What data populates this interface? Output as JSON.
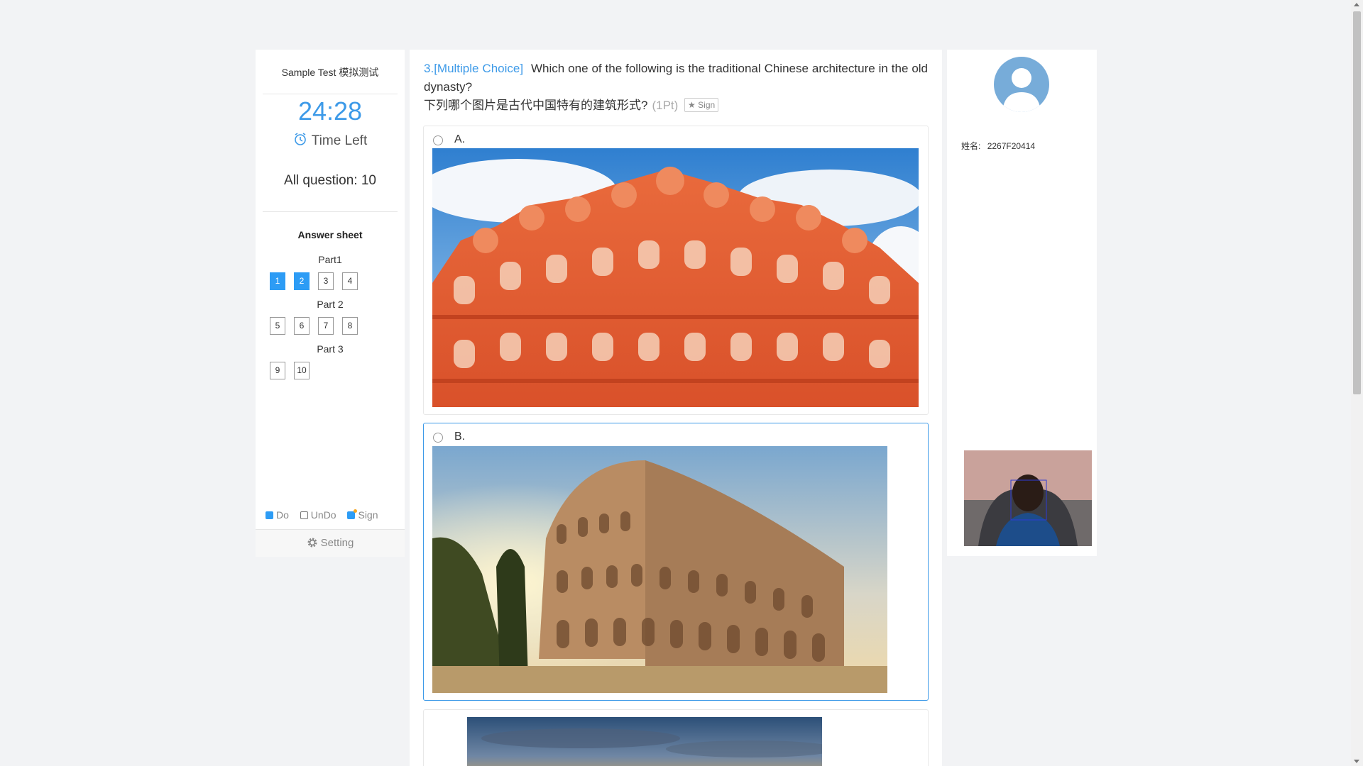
{
  "sidebar": {
    "test_title": "Sample Test 模拟测试",
    "timer": "24:28",
    "time_left_label": "Time Left",
    "all_question_label": "All question: 10",
    "answer_sheet_label": "Answer sheet",
    "parts": [
      {
        "title": "Part1",
        "questions": [
          {
            "num": "1",
            "done": true
          },
          {
            "num": "2",
            "done": true
          },
          {
            "num": "3",
            "done": false
          },
          {
            "num": "4",
            "done": false
          }
        ]
      },
      {
        "title": "Part 2",
        "questions": [
          {
            "num": "5",
            "done": false
          },
          {
            "num": "6",
            "done": false
          },
          {
            "num": "7",
            "done": false
          },
          {
            "num": "8",
            "done": false
          }
        ]
      },
      {
        "title": "Part 3",
        "questions": [
          {
            "num": "9",
            "done": false
          },
          {
            "num": "10",
            "done": false
          }
        ]
      }
    ],
    "legend": {
      "do": "Do",
      "undo": "UnDo",
      "sign": "Sign"
    },
    "setting_label": "Setting"
  },
  "question": {
    "number": "3.",
    "type": "[Multiple Choice]",
    "text_en": "Which one of the following is the traditional Chinese architecture in the old dynasty?",
    "text_zh": "下列哪个图片是古代中国特有的建筑形式?",
    "points": "(1Pt)",
    "sign_label": "Sign",
    "options": [
      {
        "label": "A.",
        "image": "hawa-mahal-palace"
      },
      {
        "label": "B.",
        "image": "colosseum"
      },
      {
        "label": "",
        "image": "city-skyline-sunset"
      }
    ]
  },
  "profile": {
    "name_label": "姓名:",
    "name_value": "2267F20414"
  },
  "colors": {
    "accent": "#3d9ae8",
    "answered": "#2d9cf5",
    "background": "#f2f3f5"
  }
}
